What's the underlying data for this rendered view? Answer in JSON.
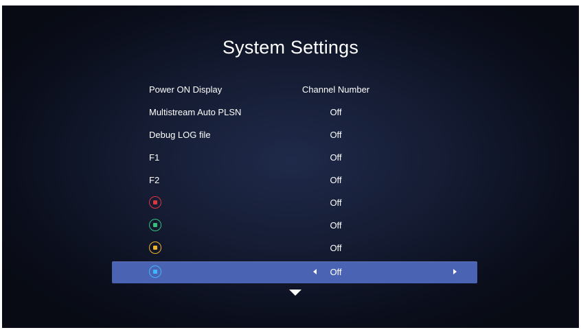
{
  "page": {
    "title": "System Settings"
  },
  "settings": [
    {
      "label": "Power ON Display",
      "value": "Channel Number"
    },
    {
      "label": "Multistream Auto PLSN",
      "value": "Off"
    },
    {
      "label": "Debug LOG file",
      "value": "Off"
    },
    {
      "label": "F1",
      "value": "Off"
    },
    {
      "label": "F2",
      "value": "Off"
    },
    {
      "key": "red-button-icon",
      "key_color": "#e0353d",
      "value": "Off"
    },
    {
      "key": "green-button-icon",
      "key_color": "#36c07a",
      "value": "Off"
    },
    {
      "key": "yellow-button-icon",
      "key_color": "#f0b429",
      "value": "Off"
    },
    {
      "key": "blue-button-icon",
      "key_color": "#3fb6ff",
      "value": "Off",
      "selected": true
    }
  ],
  "colors": {
    "selected_row": "#4b63b3",
    "background": "#151c33",
    "text": "#ffffff"
  },
  "icons": {
    "prev": "left-arrow-icon",
    "next": "right-arrow-icon",
    "more": "scroll-down-arrow-icon"
  }
}
